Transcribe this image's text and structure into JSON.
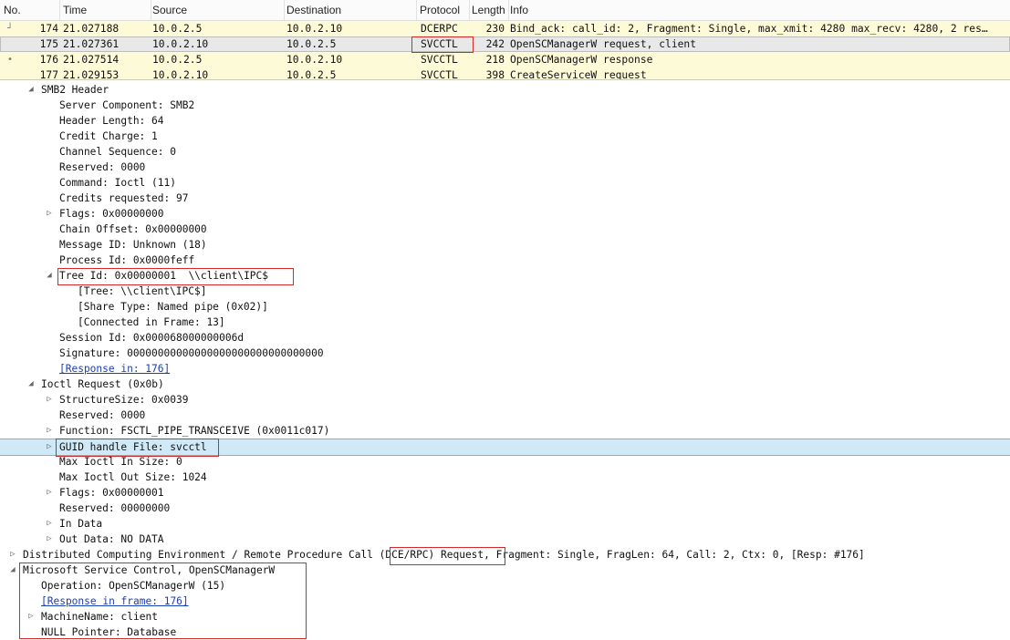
{
  "packet_list": {
    "columns": [
      "No.",
      "Time",
      "Source",
      "Destination",
      "Protocol",
      "Length",
      "Info"
    ],
    "rows": [
      {
        "no": "174",
        "time": "21.027188",
        "src": "10.0.2.5",
        "dst": "10.0.2.10",
        "proto": "DCERPC",
        "len": "230",
        "info": "Bind_ack: call_id: 2, Fragment: Single, max_xmit: 4280 max_recv: 4280, 2 res…"
      },
      {
        "no": "175",
        "time": "21.027361",
        "src": "10.0.2.10",
        "dst": "10.0.2.5",
        "proto": "SVCCTL",
        "len": "242",
        "info": "OpenSCManagerW request, client"
      },
      {
        "no": "176",
        "time": "21.027514",
        "src": "10.0.2.5",
        "dst": "10.0.2.10",
        "proto": "SVCCTL",
        "len": "218",
        "info": "OpenSCManagerW response"
      },
      {
        "no": "177",
        "time": "21.029153",
        "src": "10.0.2.10",
        "dst": "10.0.2.5",
        "proto": "SVCCTL",
        "len": "398",
        "info": "CreateServiceW request"
      }
    ]
  },
  "detail": {
    "lines": [
      "SMB2 Header",
      "Server Component: SMB2",
      "Header Length: 64",
      "Credit Charge: 1",
      "Channel Sequence: 0",
      "Reserved: 0000",
      "Command: Ioctl (11)",
      "Credits requested: 97",
      "Flags: 0x00000000",
      "Chain Offset: 0x00000000",
      "Message ID: Unknown (18)",
      "Process Id: 0x0000feff",
      "Tree Id: 0x00000001  \\\\client\\IPC$",
      "[Tree: \\\\client\\IPC$]",
      "[Share Type: Named pipe (0x02)]",
      "[Connected in Frame: 13]",
      "Session Id: 0x000068000000006d",
      "Signature: 00000000000000000000000000000000",
      "[Response in: 176]",
      "Ioctl Request (0x0b)",
      "StructureSize: 0x0039",
      "Reserved: 0000",
      "Function: FSCTL_PIPE_TRANSCEIVE (0x0011c017)",
      "GUID handle File: svcctl",
      "Max Ioctl In Size: 0",
      "Max Ioctl Out Size: 1024",
      "Flags: 0x00000001",
      "Reserved: 00000000",
      "In Data",
      "Out Data: NO DATA",
      "Distributed Computing Environment / Remote Procedure Call (DCE/RPC) Request, Fragment: Single, FragLen: 64, Call: 2, Ctx: 0, [Resp: #176]",
      "Microsoft Service Control, OpenSCManagerW",
      "Operation: OpenSCManagerW (15)",
      "[Response in frame: 176]",
      "MachineName: client",
      "NULL Pointer: Database"
    ]
  },
  "colors": {
    "row_yellow": "#fdfbd7",
    "row_selected": "#e8e8e8",
    "highlight_blue": "#cfe9f6",
    "annotation_red": "#d62828",
    "link_blue": "#1a3fb5"
  }
}
